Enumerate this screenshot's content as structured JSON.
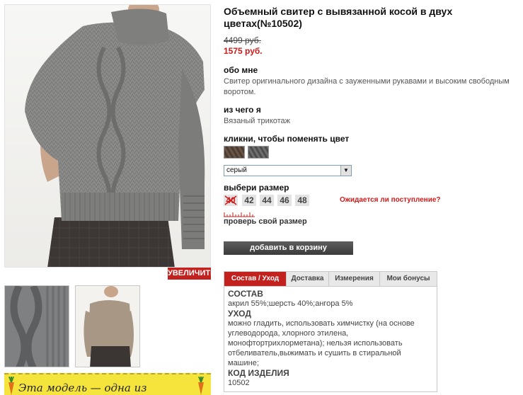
{
  "product": {
    "title": "Объемный свитер с вывязанной косой в двух цветах(№10502)",
    "old_price": "4499 руб.",
    "new_price": "1575 руб."
  },
  "about": {
    "heading": "обо мне",
    "text": "Свитер оригинального дизайна с зауженными рукавами и высоким свободным воротом."
  },
  "material": {
    "heading": "из чего я",
    "text": "Вязаный трикотаж"
  },
  "color_picker": {
    "heading": "кликни, чтобы поменять цвет",
    "swatches": [
      "brown",
      "grey"
    ],
    "selected": "серый"
  },
  "size_picker": {
    "heading": "выбери размер",
    "sizes": [
      "40",
      "42",
      "44",
      "46",
      "48"
    ],
    "unavailable": [
      "40"
    ],
    "restock_link": "Ожидается ли поступление?",
    "check_size": "проверь свой размер"
  },
  "zoom_label": "УВЕЛИЧИТЬ",
  "add_to_cart": "добавить в корзину",
  "promo_text": "Эта модель — одна из",
  "tabs": [
    {
      "label": "Состав / Уход",
      "active": true
    },
    {
      "label": "Доставка",
      "active": false
    },
    {
      "label": "Измерения",
      "active": false
    },
    {
      "label": "Мои бонусы",
      "active": false
    }
  ],
  "tab_panel": {
    "composition_heading": "СОСТАВ",
    "composition": "акрил 55%;шерсть 40%;ангора 5%",
    "care_heading": "УХОД",
    "care": "можно гладить, использовать химчистку (на основе углеводорода, хлорного этилена, монофтортрихлорметана); нельзя использовать отбеливатель,выжимать и сушить в стиральной машине;",
    "code_heading": "КОД ИЗДЕЛИЯ",
    "code": "10502"
  },
  "colors": {
    "accent": "#c3211e",
    "price_red": "#d01a1a",
    "button_dark": "#3b3b3b",
    "promo_yellow": "#f5e43c"
  }
}
